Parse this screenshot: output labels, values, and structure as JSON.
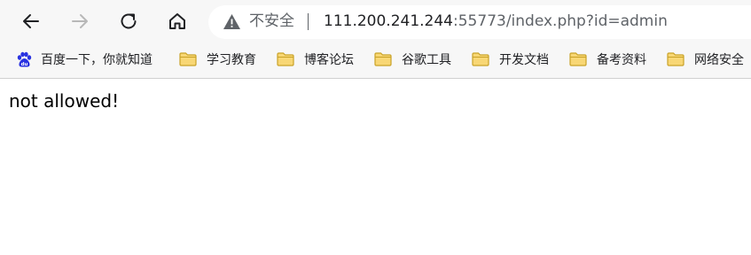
{
  "toolbar": {
    "back_icon": "back-arrow-icon",
    "forward_icon": "forward-arrow-icon",
    "reload_icon": "reload-icon",
    "home_icon": "home-icon"
  },
  "address_bar": {
    "security_label": "不安全",
    "url_host": "111.200.241.244",
    "url_rest": ":55773/index.php?id=admin"
  },
  "bookmarks": [
    {
      "label": "百度一下，你就知道",
      "icon": "baidu-paw-icon"
    },
    {
      "label": "学习教育",
      "icon": "folder-icon"
    },
    {
      "label": "博客论坛",
      "icon": "folder-icon"
    },
    {
      "label": "谷歌工具",
      "icon": "folder-icon"
    },
    {
      "label": "开发文档",
      "icon": "folder-icon"
    },
    {
      "label": "备考资料",
      "icon": "folder-icon"
    },
    {
      "label": "网络安全",
      "icon": "folder-icon"
    }
  ],
  "page": {
    "message": "not allowed!"
  },
  "colors": {
    "chrome_bg": "#f7f7f7",
    "folder_fill": "#f8d775",
    "folder_stroke": "#c9a227",
    "baidu_blue": "#2932e1"
  }
}
